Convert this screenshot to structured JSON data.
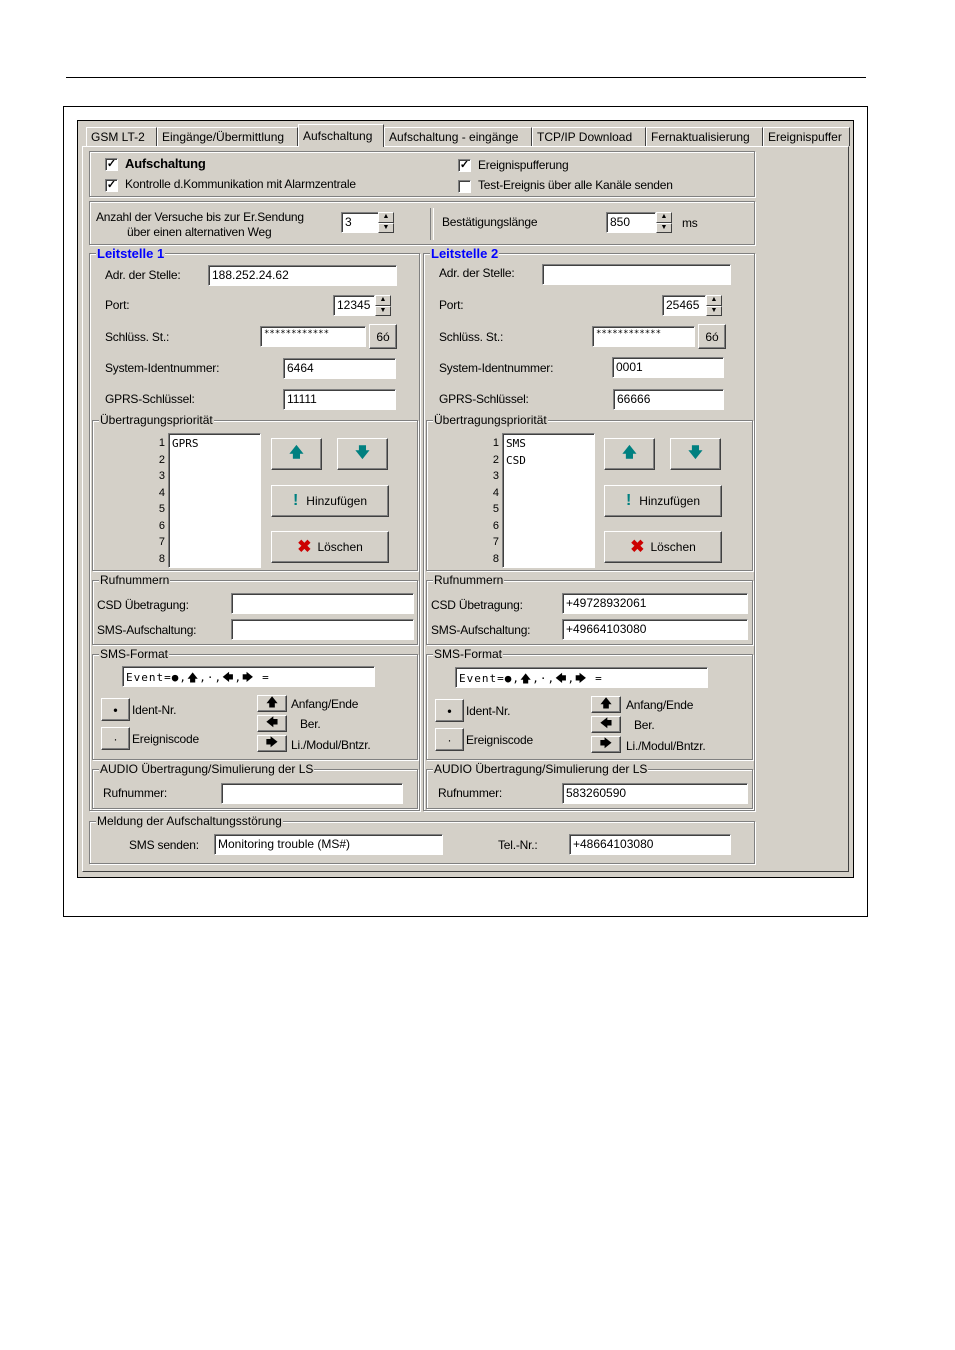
{
  "tabs": [
    "GSM LT-2",
    "Eingänge/Übermittlung",
    "Aufschaltung",
    "Aufschaltung - eingänge",
    "TCP/IP Download",
    "Fernaktualisierung",
    "Ereignispuffer"
  ],
  "top": {
    "aufschaltung": "Aufschaltung",
    "kontrolle": "Kontrolle d.Kommunikation mit Alarmzentrale",
    "ereignispufferung": "Ereignispufferung",
    "test_ereignis": "Test-Ereignis über alle Kanäle senden"
  },
  "versuche": {
    "label1": "Anzahl der Versuche bis zur Er.Sendung",
    "label2": "über einen alternativen Weg",
    "value": "3",
    "bestaetigung_label": "Bestätigungslänge",
    "bestaetigung_value": "850",
    "unit": "ms"
  },
  "labels": {
    "adr": "Adr. der Stelle:",
    "port": "Port:",
    "schluess": "Schlüss. St.:",
    "system": "System-Identnummer:",
    "gprs": "GPRS-Schlüssel:",
    "prio": "Übertragungspriorität",
    "hinzufuegen": "Hinzufügen",
    "loeschen": "Löschen",
    "rufnummern": "Rufnummern",
    "csd": "CSD Übetragung:",
    "sms_auf": "SMS-Aufschaltung:",
    "sms_format": "SMS-Format",
    "ident": "Ident-Nr.",
    "ereigniscode": "Ereigniscode",
    "anfang": "Anfang/Ende",
    "ber": "Ber.",
    "li": "Li./Modul/Bntzr.",
    "audio": "AUDIO Übertragung/Simulierung der LS",
    "rufnummer": "Rufnummer:",
    "eye": "6ó",
    "dot_btn": "•",
    "small_dot_btn": "·",
    "up_arrow": "🡅",
    "left_arrow": "🡄",
    "right_arrow": "🡆",
    "list_up": "🡅",
    "list_down": "🡇",
    "excl": "!",
    "x_icon": "✖",
    "spin_up": "▲",
    "spin_down": "▼",
    "check": "✓"
  },
  "ls1": {
    "title": "Leitstelle 1",
    "adr": "188.252.24.62",
    "port": "12345",
    "schluess": "************",
    "system": "6464",
    "gprs": "11111",
    "priority": [
      "GPRS"
    ],
    "csd": "",
    "sms": "",
    "sms_format": "Event=●,🡅,·,🡄,🡆 =",
    "audio": ""
  },
  "ls2": {
    "title": "Leitstelle 2",
    "adr": "",
    "port": "25465",
    "schluess": "************",
    "system": "0001",
    "gprs": "66666",
    "priority": [
      "SMS",
      "CSD"
    ],
    "csd": "+49728932061",
    "sms": "+49664103080",
    "sms_format": "Event=●,🡅,·,🡄,🡆 =",
    "audio": "583260590"
  },
  "prio_numbers": [
    "1",
    "2",
    "3",
    "4",
    "5",
    "6",
    "7",
    "8"
  ],
  "meldung": {
    "title": "Meldung der Aufschaltungsstörung",
    "sms_label": "SMS senden:",
    "sms_value": "Monitoring trouble (MS#)",
    "tel_label": "Tel.-Nr.:",
    "tel_value": "+48664103080"
  }
}
